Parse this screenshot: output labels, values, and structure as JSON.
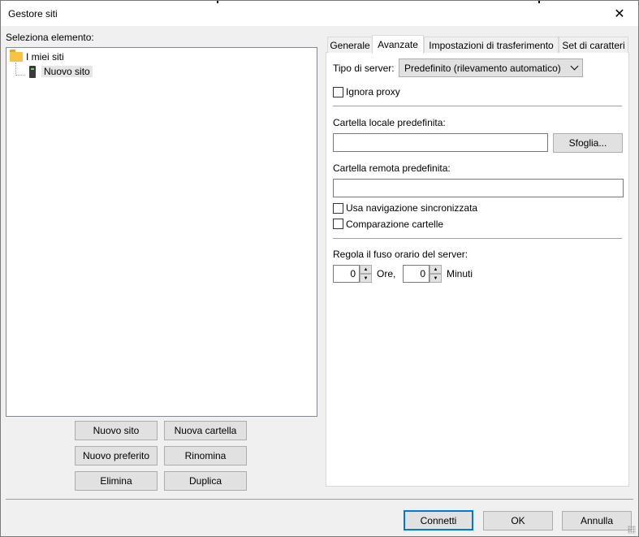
{
  "window": {
    "title": "Gestore siti",
    "close_glyph": "✕"
  },
  "left": {
    "select_label": "Seleziona elemento:",
    "tree": [
      {
        "label": "I miei siti",
        "icon": "folder-icon"
      },
      {
        "label": "Nuovo sito",
        "icon": "server-icon"
      }
    ],
    "buttons": {
      "new_site": "Nuovo sito",
      "new_folder": "Nuova cartella",
      "new_bookmark": "Nuovo preferito",
      "rename": "Rinomina",
      "delete": "Elimina",
      "duplicate": "Duplica"
    }
  },
  "tabs": [
    {
      "label": "Generale"
    },
    {
      "label": "Avanzate",
      "active": true
    },
    {
      "label": "Impostazioni di trasferimento"
    },
    {
      "label": "Set di caratteri"
    }
  ],
  "advanced": {
    "server_type_label": "Tipo di server:",
    "server_type_value": "Predefinito (rilevamento automatico)",
    "ignore_proxy": {
      "label": "Ignora proxy",
      "checked": false
    },
    "local_folder_label": "Cartella locale predefinita:",
    "local_folder_value": "",
    "browse_button": "Sfoglia...",
    "remote_folder_label": "Cartella remota predefinita:",
    "remote_folder_value": "",
    "sync_browsing": {
      "label": "Usa navigazione sincronizzata",
      "checked": false
    },
    "dir_comparison": {
      "label": "Comparazione cartelle",
      "checked": false
    },
    "timezone_label": "Regola il fuso orario del server:",
    "hours_value": "0",
    "hours_label": "Ore,",
    "minutes_value": "0",
    "minutes_label": "Minuti"
  },
  "footer": {
    "connect": "Connetti",
    "ok": "OK",
    "cancel": "Annulla"
  }
}
